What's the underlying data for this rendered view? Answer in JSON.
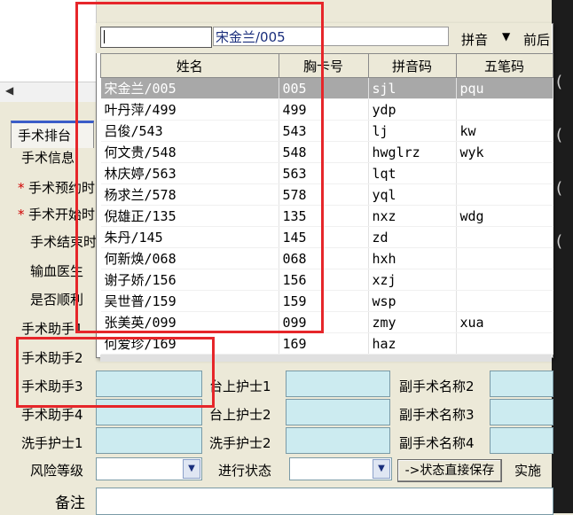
{
  "left_panel": {
    "tab_label": "手术排台",
    "section_label": "手术信息",
    "labels": {
      "planned_time": "手术预约时",
      "start_time": "手术开始时",
      "end_time": "手术结束时",
      "blood_doctor": "输血医生",
      "smooth": "是否顺利",
      "assistant1": "手术助手1",
      "assistant2": "手术助手2",
      "assistant3": "手术助手3",
      "assistant4": "手术助手4",
      "scrub_nurse1": "洗手护士1",
      "risk_level": "风险等级",
      "remark": "备注"
    },
    "required_mark": "*"
  },
  "middle_labels": {
    "table_nurse1": "台上护士1",
    "table_nurse2": "台上护士2",
    "scrub_nurse2": "洗手护士2",
    "progress_status": "进行状态"
  },
  "right_labels": {
    "sub_surgery2": "副手术名称2",
    "sub_surgery3": "副手术名称3",
    "sub_surgery4": "副手术名称4",
    "implement": "实施"
  },
  "save_button": "->状态直接保存",
  "popup": {
    "search_value": "",
    "selected_display": "宋金兰/005",
    "pinyin_option": "拼音",
    "front_option": "前后",
    "columns": [
      "姓名",
      "胸卡号",
      "拼音码",
      "五笔码"
    ],
    "rows": [
      {
        "name": "宋金兰/005",
        "card": "005",
        "pinyin": "sjl",
        "wubi": "pqu"
      },
      {
        "name": "叶丹萍/499",
        "card": "499",
        "pinyin": "ydp",
        "wubi": ""
      },
      {
        "name": "吕俊/543",
        "card": "543",
        "pinyin": "lj",
        "wubi": "kw"
      },
      {
        "name": "何文贵/548",
        "card": "548",
        "pinyin": "hwglrz",
        "wubi": "wyk"
      },
      {
        "name": "林庆婷/563",
        "card": "563",
        "pinyin": "lqt",
        "wubi": ""
      },
      {
        "name": "杨求兰/578",
        "card": "578",
        "pinyin": "yql",
        "wubi": ""
      },
      {
        "name": "倪雄正/135",
        "card": "135",
        "pinyin": "nxz",
        "wubi": "wdg"
      },
      {
        "name": "朱丹/145",
        "card": "145",
        "pinyin": "zd",
        "wubi": ""
      },
      {
        "name": "何新焕/068",
        "card": "068",
        "pinyin": "hxh",
        "wubi": ""
      },
      {
        "name": "谢子娇/156",
        "card": "156",
        "pinyin": "xzj",
        "wubi": ""
      },
      {
        "name": "吴世普/159",
        "card": "159",
        "pinyin": "wsp",
        "wubi": ""
      },
      {
        "name": "张美英/099",
        "card": "099",
        "pinyin": "zmy",
        "wubi": "xua"
      },
      {
        "name": "何爱珍/169",
        "card": "169",
        "pinyin": "haz",
        "wubi": ""
      }
    ],
    "selected_row": 0
  },
  "colors": {
    "highlight": "#e6262a",
    "field": "#ccebf0",
    "selected_row": "#a8a8a8"
  }
}
